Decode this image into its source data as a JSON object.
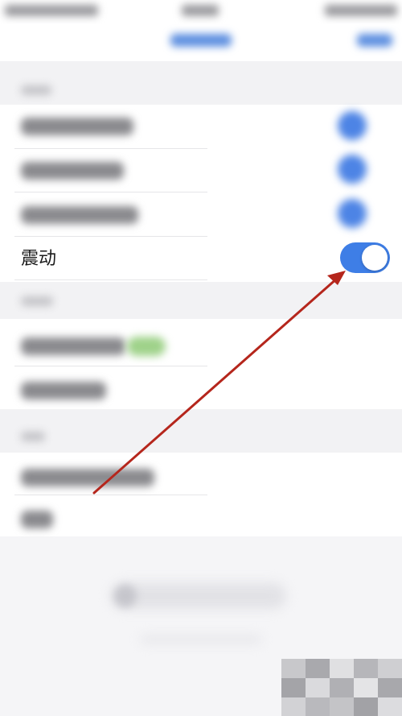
{
  "settings": {
    "vibration": {
      "label": "震动",
      "enabled": true
    }
  },
  "colors": {
    "toggle_on": "#3e7ee6",
    "annotation_arrow": "#b5261c",
    "badge_green": "#9fd28a"
  }
}
